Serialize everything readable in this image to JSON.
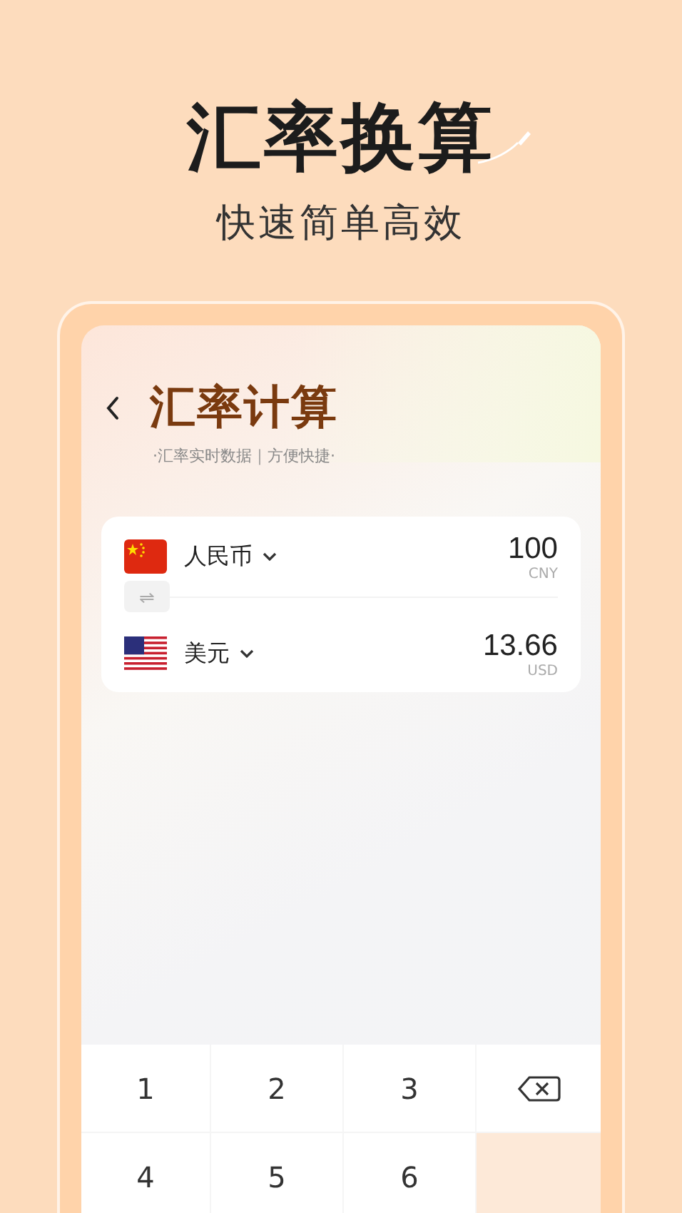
{
  "headline": "汇率换算",
  "subheadline": "快速简单高效",
  "screen": {
    "title": "汇率计算",
    "subtitle": "·汇率实时数据｜方便快捷·"
  },
  "currencies": [
    {
      "kind": "cn",
      "name": "人民币",
      "amount": "100",
      "code": "CNY"
    },
    {
      "kind": "us",
      "name": "美元",
      "amount": "13.66",
      "code": "USD"
    }
  ],
  "swap": "⇌",
  "keypad": [
    "1",
    "2",
    "3",
    "4",
    "5",
    "6"
  ]
}
